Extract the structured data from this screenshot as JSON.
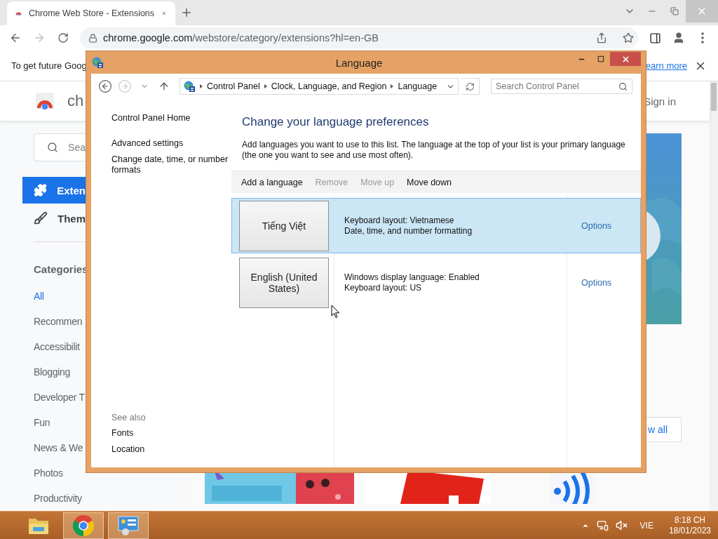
{
  "browser": {
    "tabs": [
      {
        "title": "Chrome Web Store - Extensions",
        "selected": true
      }
    ],
    "url": {
      "host": "chrome.google.com",
      "path": "/webstore/category/extensions?hl=en-GB"
    },
    "infobar": {
      "text": "To get future Goog",
      "link": "earn more"
    }
  },
  "store": {
    "brand": "ch",
    "sign_in": "Sign in",
    "search": {
      "placeholder": "Sea"
    },
    "nav": [
      {
        "kind": "extensions",
        "label": "Exten",
        "selected": true
      },
      {
        "kind": "themes",
        "label": "Them",
        "selected": false
      }
    ],
    "categories_title": "Categories",
    "categories": [
      {
        "label": "All",
        "selected": true
      },
      {
        "label": "Recommen",
        "selected": false
      },
      {
        "label": "Accessibilit",
        "selected": false
      },
      {
        "label": "Blogging",
        "selected": false
      },
      {
        "label": "Developer T",
        "selected": false
      },
      {
        "label": "Fun",
        "selected": false
      },
      {
        "label": "News & We",
        "selected": false
      },
      {
        "label": "Photos",
        "selected": false
      },
      {
        "label": "Productivity",
        "selected": false
      }
    ],
    "view_all": "w all"
  },
  "dialog": {
    "title": "Language",
    "nav_buttons": [
      {
        "kind": "back",
        "disabled": false
      },
      {
        "kind": "forward",
        "disabled": true
      }
    ],
    "breadcrumb": [
      "Control Panel",
      "Clock, Language, and Region",
      "Language"
    ],
    "search": {
      "placeholder": "Search Control Panel"
    },
    "sidebar": {
      "home": "Control Panel Home",
      "links": [
        "Advanced settings",
        "Change date, time, or number formats"
      ],
      "see_also_title": "See also",
      "see_also": [
        "Fonts",
        "Location"
      ]
    },
    "heading": "Change your language preferences",
    "description": "Add languages you want to use to this list. The language at the top of your list is your primary language (the one you want to see and use most often).",
    "toolbar": [
      {
        "label": "Add a language",
        "disabled": false
      },
      {
        "label": "Remove",
        "disabled": true
      },
      {
        "label": "Move up",
        "disabled": true
      },
      {
        "label": "Move down",
        "disabled": false
      }
    ],
    "languages": [
      {
        "name": "Tiếng Việt",
        "details": [
          "Keyboard layout: Vietnamese",
          "Date, time, and number formatting"
        ],
        "options": "Options",
        "selected": true
      },
      {
        "name": "English (United States)",
        "details": [
          "Windows display language: Enabled",
          "Keyboard layout: US"
        ],
        "options": "Options",
        "selected": false
      }
    ]
  },
  "taskbar": {
    "apps": [
      {
        "kind": "explorer",
        "running": false
      },
      {
        "kind": "chrome",
        "running": true
      },
      {
        "kind": "control-panel",
        "running": true
      }
    ],
    "language": "VIE",
    "time": "8:18 CH",
    "date": "18/01/2023"
  }
}
